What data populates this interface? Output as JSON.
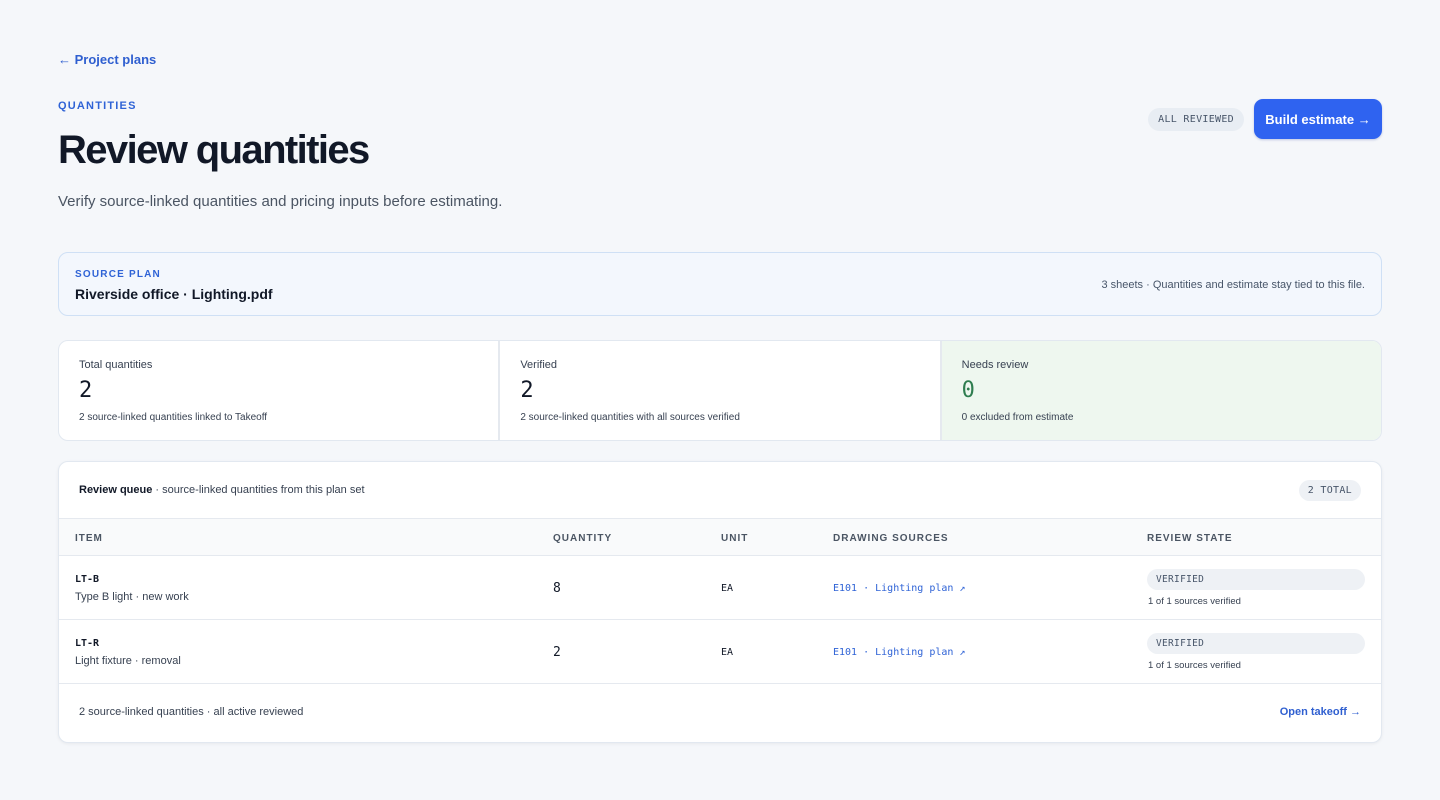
{
  "nav": {
    "back_label": "← Project plans"
  },
  "header": {
    "eyebrow": "QUANTITIES",
    "title": "Review quantities",
    "subtitle": "Verify source-linked quantities and pricing inputs before estimating.",
    "status_pill": "ALL REVIEWED",
    "primary_action": "Build estimate →"
  },
  "source": {
    "label": "SOURCE PLAN",
    "file": "Riverside office · Lighting.pdf",
    "meta": "3 sheets · Quantities and estimate stay tied to this file."
  },
  "stats": [
    {
      "label": "Total quantities",
      "value": "2",
      "note": "2 source-linked quantities linked to Takeoff"
    },
    {
      "label": "Verified",
      "value": "2",
      "note": "2 source-linked quantities with all sources verified"
    },
    {
      "label": "Needs review",
      "value": "0",
      "note": "0 excluded from estimate",
      "accent": "#2e7d4f"
    }
  ],
  "queue": {
    "title": "Review queue",
    "title_suffix": " · source-linked quantities from this plan set",
    "total_pill": "2 TOTAL",
    "columns": [
      "ITEM",
      "QUANTITY",
      "UNIT",
      "DRAWING SOURCES",
      "REVIEW STATE"
    ],
    "rows": [
      {
        "code": "LT-B",
        "desc": "Type B light · new work",
        "quantity": "8",
        "unit": "EA",
        "source": "E101 · Lighting plan ↗",
        "state": "VERIFIED",
        "state_note": "1 of 1 sources verified"
      },
      {
        "code": "LT-R",
        "desc": "Light fixture · removal",
        "quantity": "2",
        "unit": "EA",
        "source": "E101 · Lighting plan ↗",
        "state": "VERIFIED",
        "state_note": "1 of 1 sources verified"
      }
    ],
    "footer_note": "2 source-linked quantities · all active reviewed",
    "footer_link": "Open takeoff →"
  },
  "colors": {
    "accent": "#2f63f0",
    "link": "#2f5fd0",
    "success_bg": "#eef7ef"
  }
}
